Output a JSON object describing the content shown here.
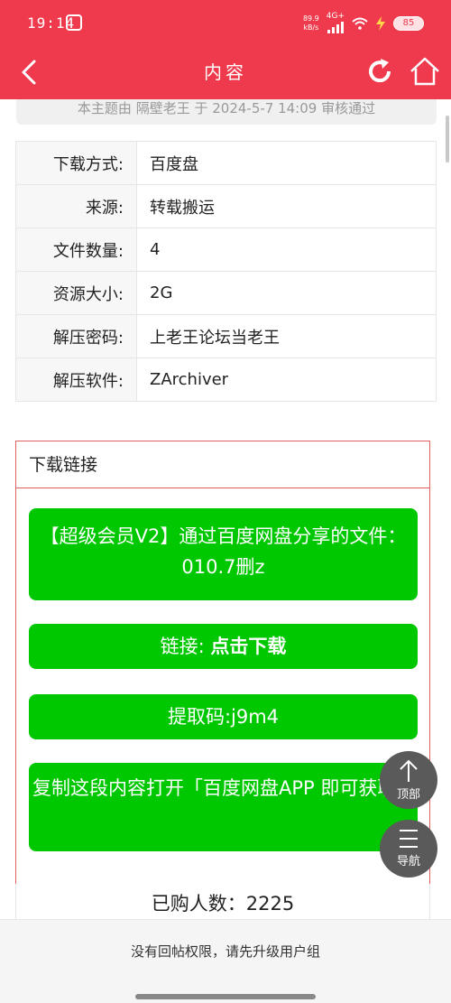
{
  "status_bar": {
    "time": "19:14",
    "net_speed": "89.9",
    "net_unit": "kB/s",
    "network": "4G+",
    "battery": "85"
  },
  "nav": {
    "title": "内容"
  },
  "review_notice": "本主题由 隔壁老王 于 2024-5-7 14:09 审核通过",
  "info": [
    {
      "key": "下载方式:",
      "value": "百度盘"
    },
    {
      "key": "来源:",
      "value": "转载搬运"
    },
    {
      "key": "文件数量:",
      "value": "4"
    },
    {
      "key": "资源大小:",
      "value": "2G"
    },
    {
      "key": "解压密码:",
      "value": "上老王论坛当老王"
    },
    {
      "key": "解压软件:",
      "value": "ZArchiver"
    }
  ],
  "download": {
    "heading": "下载链接",
    "share_text": "【超级会员V2】通过百度网盘分享的文件：010.7删z",
    "link_prefix": "链接: ",
    "link_action": "点击下载",
    "extract_code": "提取码:j9m4",
    "copy_text": "复制这段内容打开「百度网盘APP 即可获取」"
  },
  "buyers": "已购人数：2225",
  "fab": {
    "top_label": "顶部",
    "guide_label": "导航"
  },
  "bottom_notice": "没有回帖权限，请先升级用户组",
  "colors": {
    "header": "#ee3a4c",
    "button_green": "#00c800",
    "border_red": "#e06060"
  }
}
